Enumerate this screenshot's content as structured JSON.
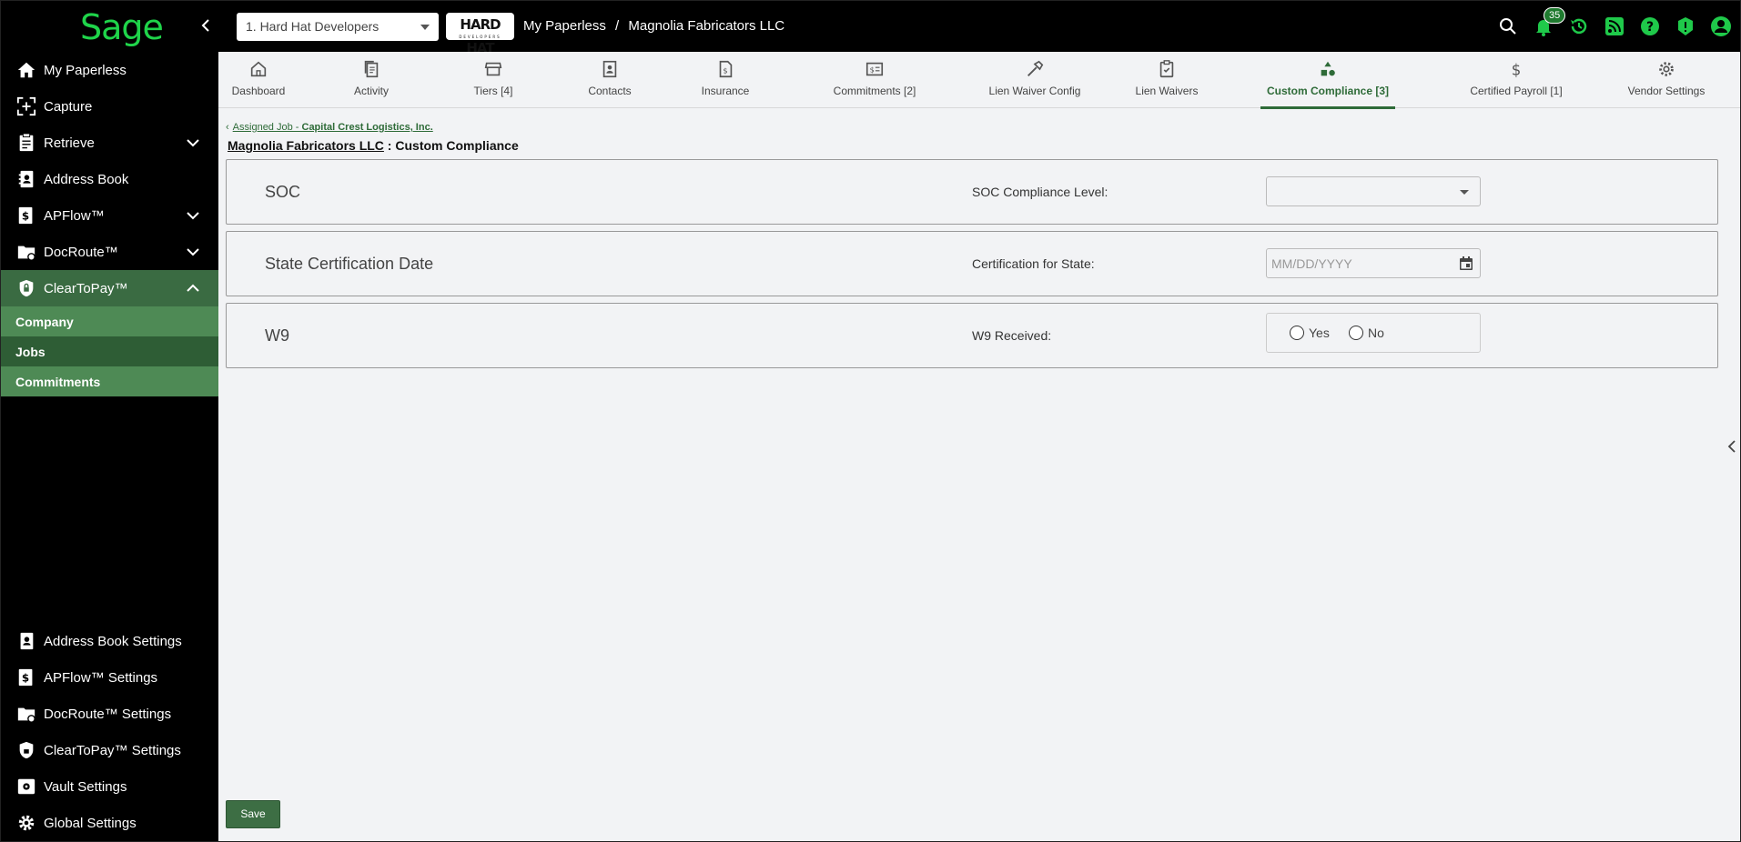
{
  "app": {
    "logo": "Sage"
  },
  "header": {
    "org_select": "1. Hard Hat Developers",
    "brand_logo": "HARD HAT",
    "brand_logo_sub": "DEVELOPERS",
    "breadcrumb": [
      "My Paperless",
      "/",
      "Magnolia Fabricators LLC"
    ],
    "notification_count": "35",
    "icons": [
      "search-icon",
      "bell-icon",
      "history-icon",
      "rss-icon",
      "help-icon",
      "alert-icon",
      "user-icon"
    ]
  },
  "sidebar": {
    "items": [
      {
        "label": "My Paperless",
        "icon": "home-icon"
      },
      {
        "label": "Capture",
        "icon": "capture-icon"
      },
      {
        "label": "Retrieve",
        "icon": "clipboard-icon"
      },
      {
        "label": "Address Book",
        "icon": "address-book-icon"
      },
      {
        "label": "APFlow™",
        "icon": "dollar-doc-icon"
      },
      {
        "label": "DocRoute™",
        "icon": "folder-route-icon"
      },
      {
        "label": "ClearToPay™",
        "icon": "shield-lock-icon"
      }
    ],
    "subitems": [
      "Company",
      "Jobs",
      "Commitments"
    ],
    "settings": [
      {
        "label": "Address Book Settings"
      },
      {
        "label": "APFlow™ Settings"
      },
      {
        "label": "DocRoute™ Settings"
      },
      {
        "label": "ClearToPay™ Settings"
      },
      {
        "label": "Vault Settings"
      },
      {
        "label": "Global Settings"
      }
    ]
  },
  "tabs": [
    {
      "label": "Dashboard",
      "icon": "house-icon"
    },
    {
      "label": "Activity",
      "icon": "documents-icon"
    },
    {
      "label": "Tiers [4]",
      "icon": "store-icon"
    },
    {
      "label": "Contacts",
      "icon": "contact-book-icon"
    },
    {
      "label": "Insurance",
      "icon": "insurance-doc-icon"
    },
    {
      "label": "Commitments [2]",
      "icon": "money-doc-icon"
    },
    {
      "label": "Lien Waiver Config",
      "icon": "hammer-icon"
    },
    {
      "label": "Lien Waivers",
      "icon": "clipboard-check-icon"
    },
    {
      "label": "Custom Compliance [3]",
      "icon": "shapes-icon"
    },
    {
      "label": "Certified Payroll [1]",
      "icon": "dollar-icon"
    },
    {
      "label": "Vendor Settings",
      "icon": "gear-icon"
    }
  ],
  "content": {
    "back_link_prefix": "Assigned Job - ",
    "back_link_job": "Capital Crest Logistics, Inc.",
    "title_vendor": "Magnolia Fabricators LLC",
    "title_separator": " : ",
    "title_section": "Custom Compliance",
    "cards": [
      {
        "title": "SOC",
        "field_label": "SOC Compliance Level:",
        "value": ""
      },
      {
        "title": "State Certification Date",
        "field_label": "Certification for State:",
        "placeholder": "MM/DD/YYYY"
      },
      {
        "title": "W9",
        "field_label": "W9 Received:",
        "options": [
          "Yes",
          "No"
        ]
      }
    ],
    "save_label": "Save"
  }
}
